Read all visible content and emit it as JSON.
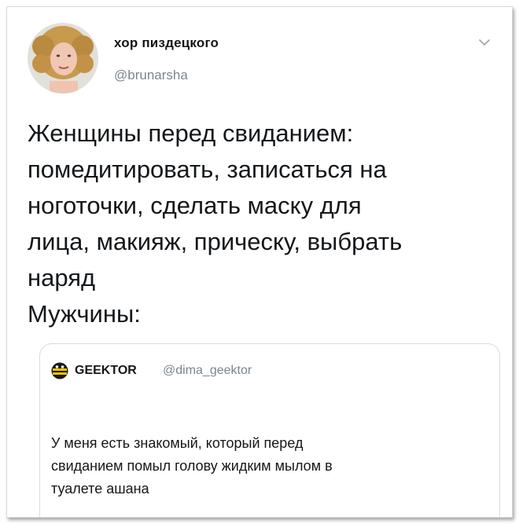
{
  "tweet": {
    "author": {
      "display_name": "хор пиздецкого",
      "handle": "@brunarsha"
    },
    "menu_icon": "chevron-down-icon",
    "text": "Женщины перед свиданием:\nпомедитировать, записаться на\nноготочки, сделать маску для\nлица, макияж, прическу, выбрать\nнаряд\nМужчины:",
    "quoted_tweet": {
      "author": {
        "display_name": "GEEKTOR",
        "handle": "@dima_geektor",
        "avatar_icon": "bee-face-icon"
      },
      "text": "У меня есть знакомый, который перед\nсвиданием помыл голову жидким мылом в\nтуалете ашана"
    }
  },
  "colors": {
    "text_primary": "#14171a",
    "text_secondary": "#7a8691",
    "border": "#d6dce1"
  }
}
